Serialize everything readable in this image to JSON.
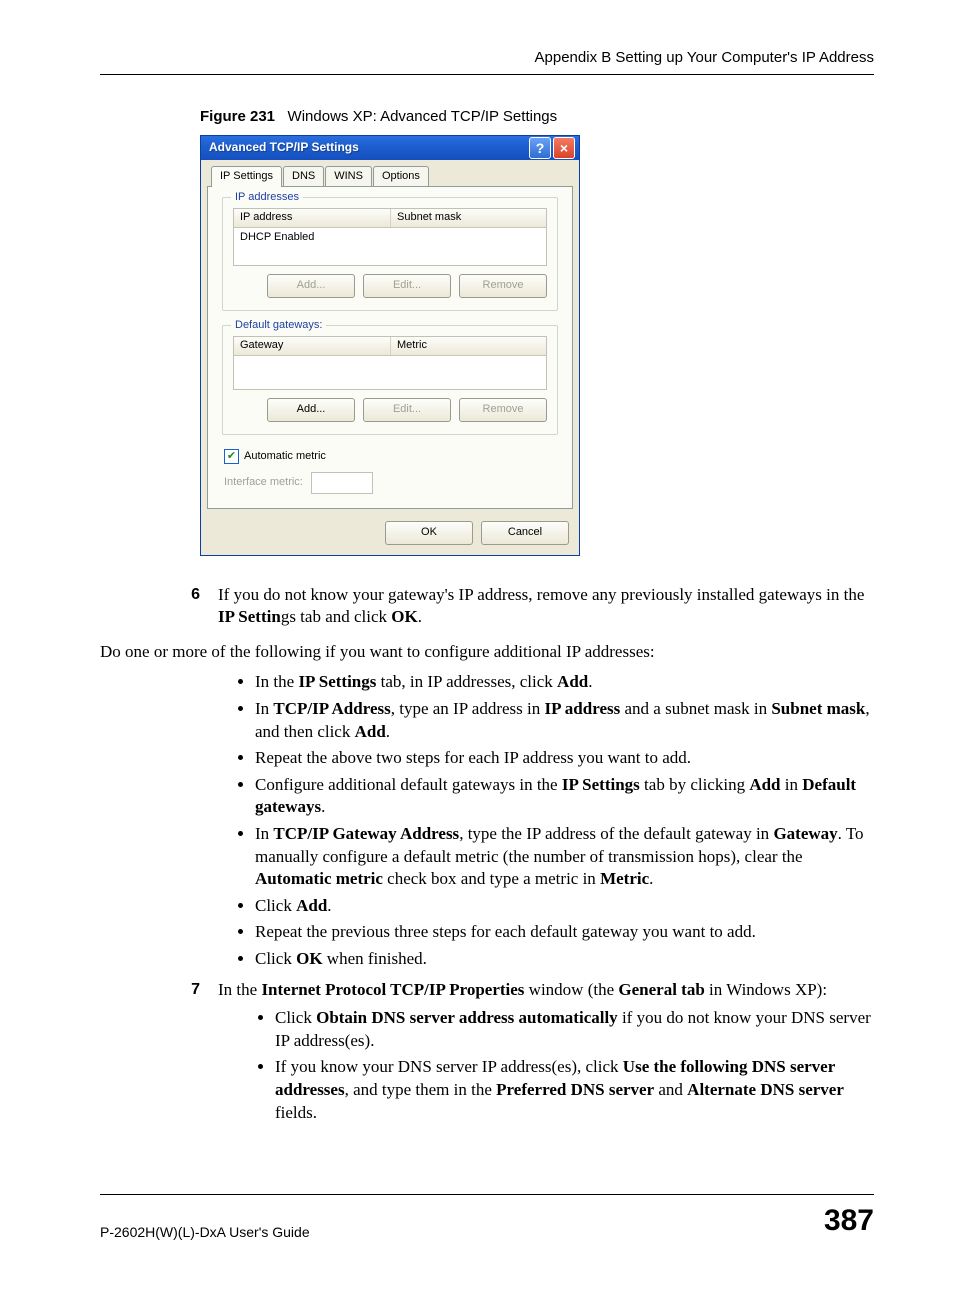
{
  "header": {
    "running": "Appendix B Setting up Your Computer's IP Address"
  },
  "figure": {
    "label": "Figure 231",
    "title": "Windows XP: Advanced TCP/IP Settings"
  },
  "dialog": {
    "title": "Advanced TCP/IP Settings",
    "tabs": {
      "ip": "IP Settings",
      "dns": "DNS",
      "wins": "WINS",
      "options": "Options"
    },
    "groups": {
      "ip": {
        "legend": "IP addresses",
        "col_a": "IP address",
        "col_b": "Subnet mask",
        "row1": "DHCP Enabled"
      },
      "gw": {
        "legend": "Default gateways:",
        "col_a": "Gateway",
        "col_b": "Metric"
      }
    },
    "buttons": {
      "add": "Add...",
      "edit": "Edit...",
      "remove": "Remove",
      "ok": "OK",
      "cancel": "Cancel"
    },
    "metric": {
      "auto_label": "Automatic metric",
      "iface_label": "Interface metric:"
    }
  },
  "steps": {
    "s6_m": "If you do not know your gateway's IP address, remove any previously installed gateways in the ",
    "s6_b1": "IP Settin",
    "s6_m2": "gs tab and click ",
    "s6_b2": "OK",
    "intro": "Do one or more of the following if you want to configure additional IP addresses:",
    "b1": {
      "p1": "In the ",
      "b1": "IP Settings",
      "p2": " tab, in IP addresses, click ",
      "b2": "Add",
      "p3": "."
    },
    "b2": {
      "p1": "In ",
      "b1": "TCP/IP Address",
      "p2": ", type an IP address in ",
      "b2": "IP address",
      "p3": " and a subnet mask in ",
      "b3": "Subnet mask",
      "p4": ", and then click ",
      "b4": "Add",
      "p5": "."
    },
    "b3": "Repeat the above two steps for each IP address you want to add.",
    "b4": {
      "p1": "Configure additional default gateways in the ",
      "b1": "IP Settings",
      "p2": " tab by clicking ",
      "b2": "Add",
      "p3": " in ",
      "b3": "Default gateways",
      "p4": "."
    },
    "b5": {
      "p1": "In ",
      "b1": "TCP/IP Gateway Address",
      "p2": ", type the IP address of the default gateway in ",
      "b2": "Gateway",
      "p3": ". To manually configure a default metric (the number of transmission hops), clear the ",
      "b3": "Automatic metric",
      "p4": " check box and type a metric in ",
      "b4": "Metric",
      "p5": "."
    },
    "b6": {
      "p1": "Click ",
      "b1": "Add",
      "p2": "."
    },
    "b7": "Repeat the previous three steps for each default gateway you want to add.",
    "b8": {
      "p1": "Click ",
      "b1": "OK",
      "p2": " when finished."
    },
    "s7": {
      "p1": "In the ",
      "b1": "Internet Protocol TCP/IP Properties",
      "p2": " window (the ",
      "b2": "General tab",
      "p3": " in Windows XP):"
    },
    "s7b1": {
      "p1": "Click ",
      "b1": "Obtain DNS server address automatically",
      "p2": " if you do not know your DNS server IP address(es)."
    },
    "s7b2": {
      "p1": "If you know your DNS server IP address(es), click ",
      "b1": "Use the following DNS server addresses",
      "p2": ", and type them in the ",
      "b2": "Preferred DNS server",
      "p3": " and ",
      "b3": "Alternate DNS server",
      "p4": " fields."
    }
  },
  "footer": {
    "guide": "P-2602H(W)(L)-DxA User's Guide",
    "page": "387"
  }
}
